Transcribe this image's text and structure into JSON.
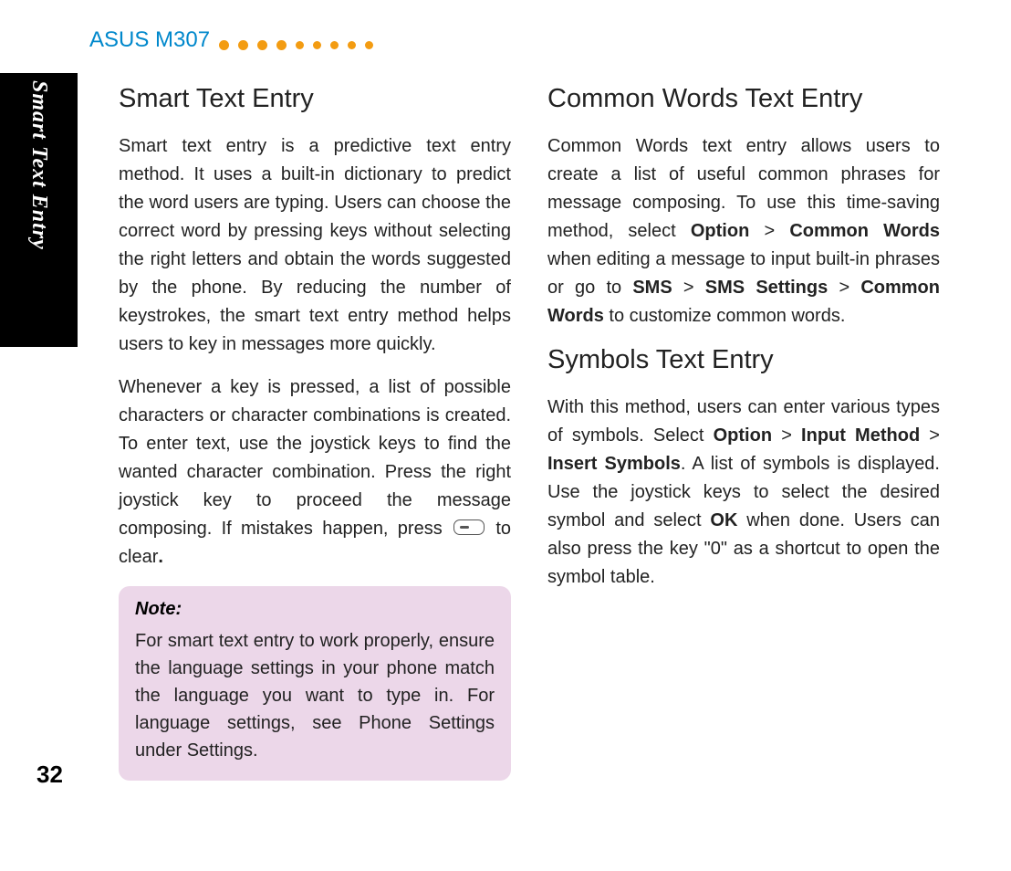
{
  "header": {
    "title": "ASUS M307"
  },
  "sideTab": "Smart Text Entry",
  "pageNumber": "32",
  "left": {
    "h1": "Smart Text Entry",
    "p1": "Smart text entry is a predictive text entry method. It uses a built-in dictionary to predict the word users are typing. Users can choose the correct word by pressing keys without selecting the right letters and obtain the words suggested by the phone. By reducing the number of keystrokes, the smart text entry method helps users to key in messages more quickly.",
    "p2a": "Whenever a key is pressed, a list of possible characters or character combinations is created. To enter text, use the joystick keys to find the wanted character combination. Press the right joystick key to proceed the message composing. If mistakes happen, press ",
    "p2b": " to clear",
    "p2c": ".",
    "note": {
      "title": "Note:",
      "body": "For smart text entry to work properly, ensure the language settings in your phone match the language you want to type in. For language settings, see Phone Settings under Settings."
    }
  },
  "right": {
    "h1": "Common Words Text Entry",
    "p1_parts": {
      "t1": "Common Words text entry allows users to create a list of useful common phrases for message composing. To use this time-saving method, select ",
      "b1": "Option",
      "t2": " > ",
      "b2": "Common Words",
      "t3": " when editing a message to input built-in phrases or go to ",
      "b3": "SMS",
      "t4": " > ",
      "b4": "SMS Settings",
      "t5": " > ",
      "b5": "Common Words",
      "t6": " to customize common words."
    },
    "h2": "Symbols Text Entry",
    "p2_parts": {
      "t1": "With this method, users can enter various types of symbols. Select ",
      "b1": "Option",
      "t2": " > ",
      "b2": "Input Method",
      "t3": " > ",
      "b3": " Insert Symbols",
      "t4": ". A list of symbols is displayed. Use the joystick keys to select the desired symbol and select ",
      "b4": "OK",
      "t5": " when done. Users can also press the key \"0\" as a shortcut to open the symbol table."
    }
  }
}
